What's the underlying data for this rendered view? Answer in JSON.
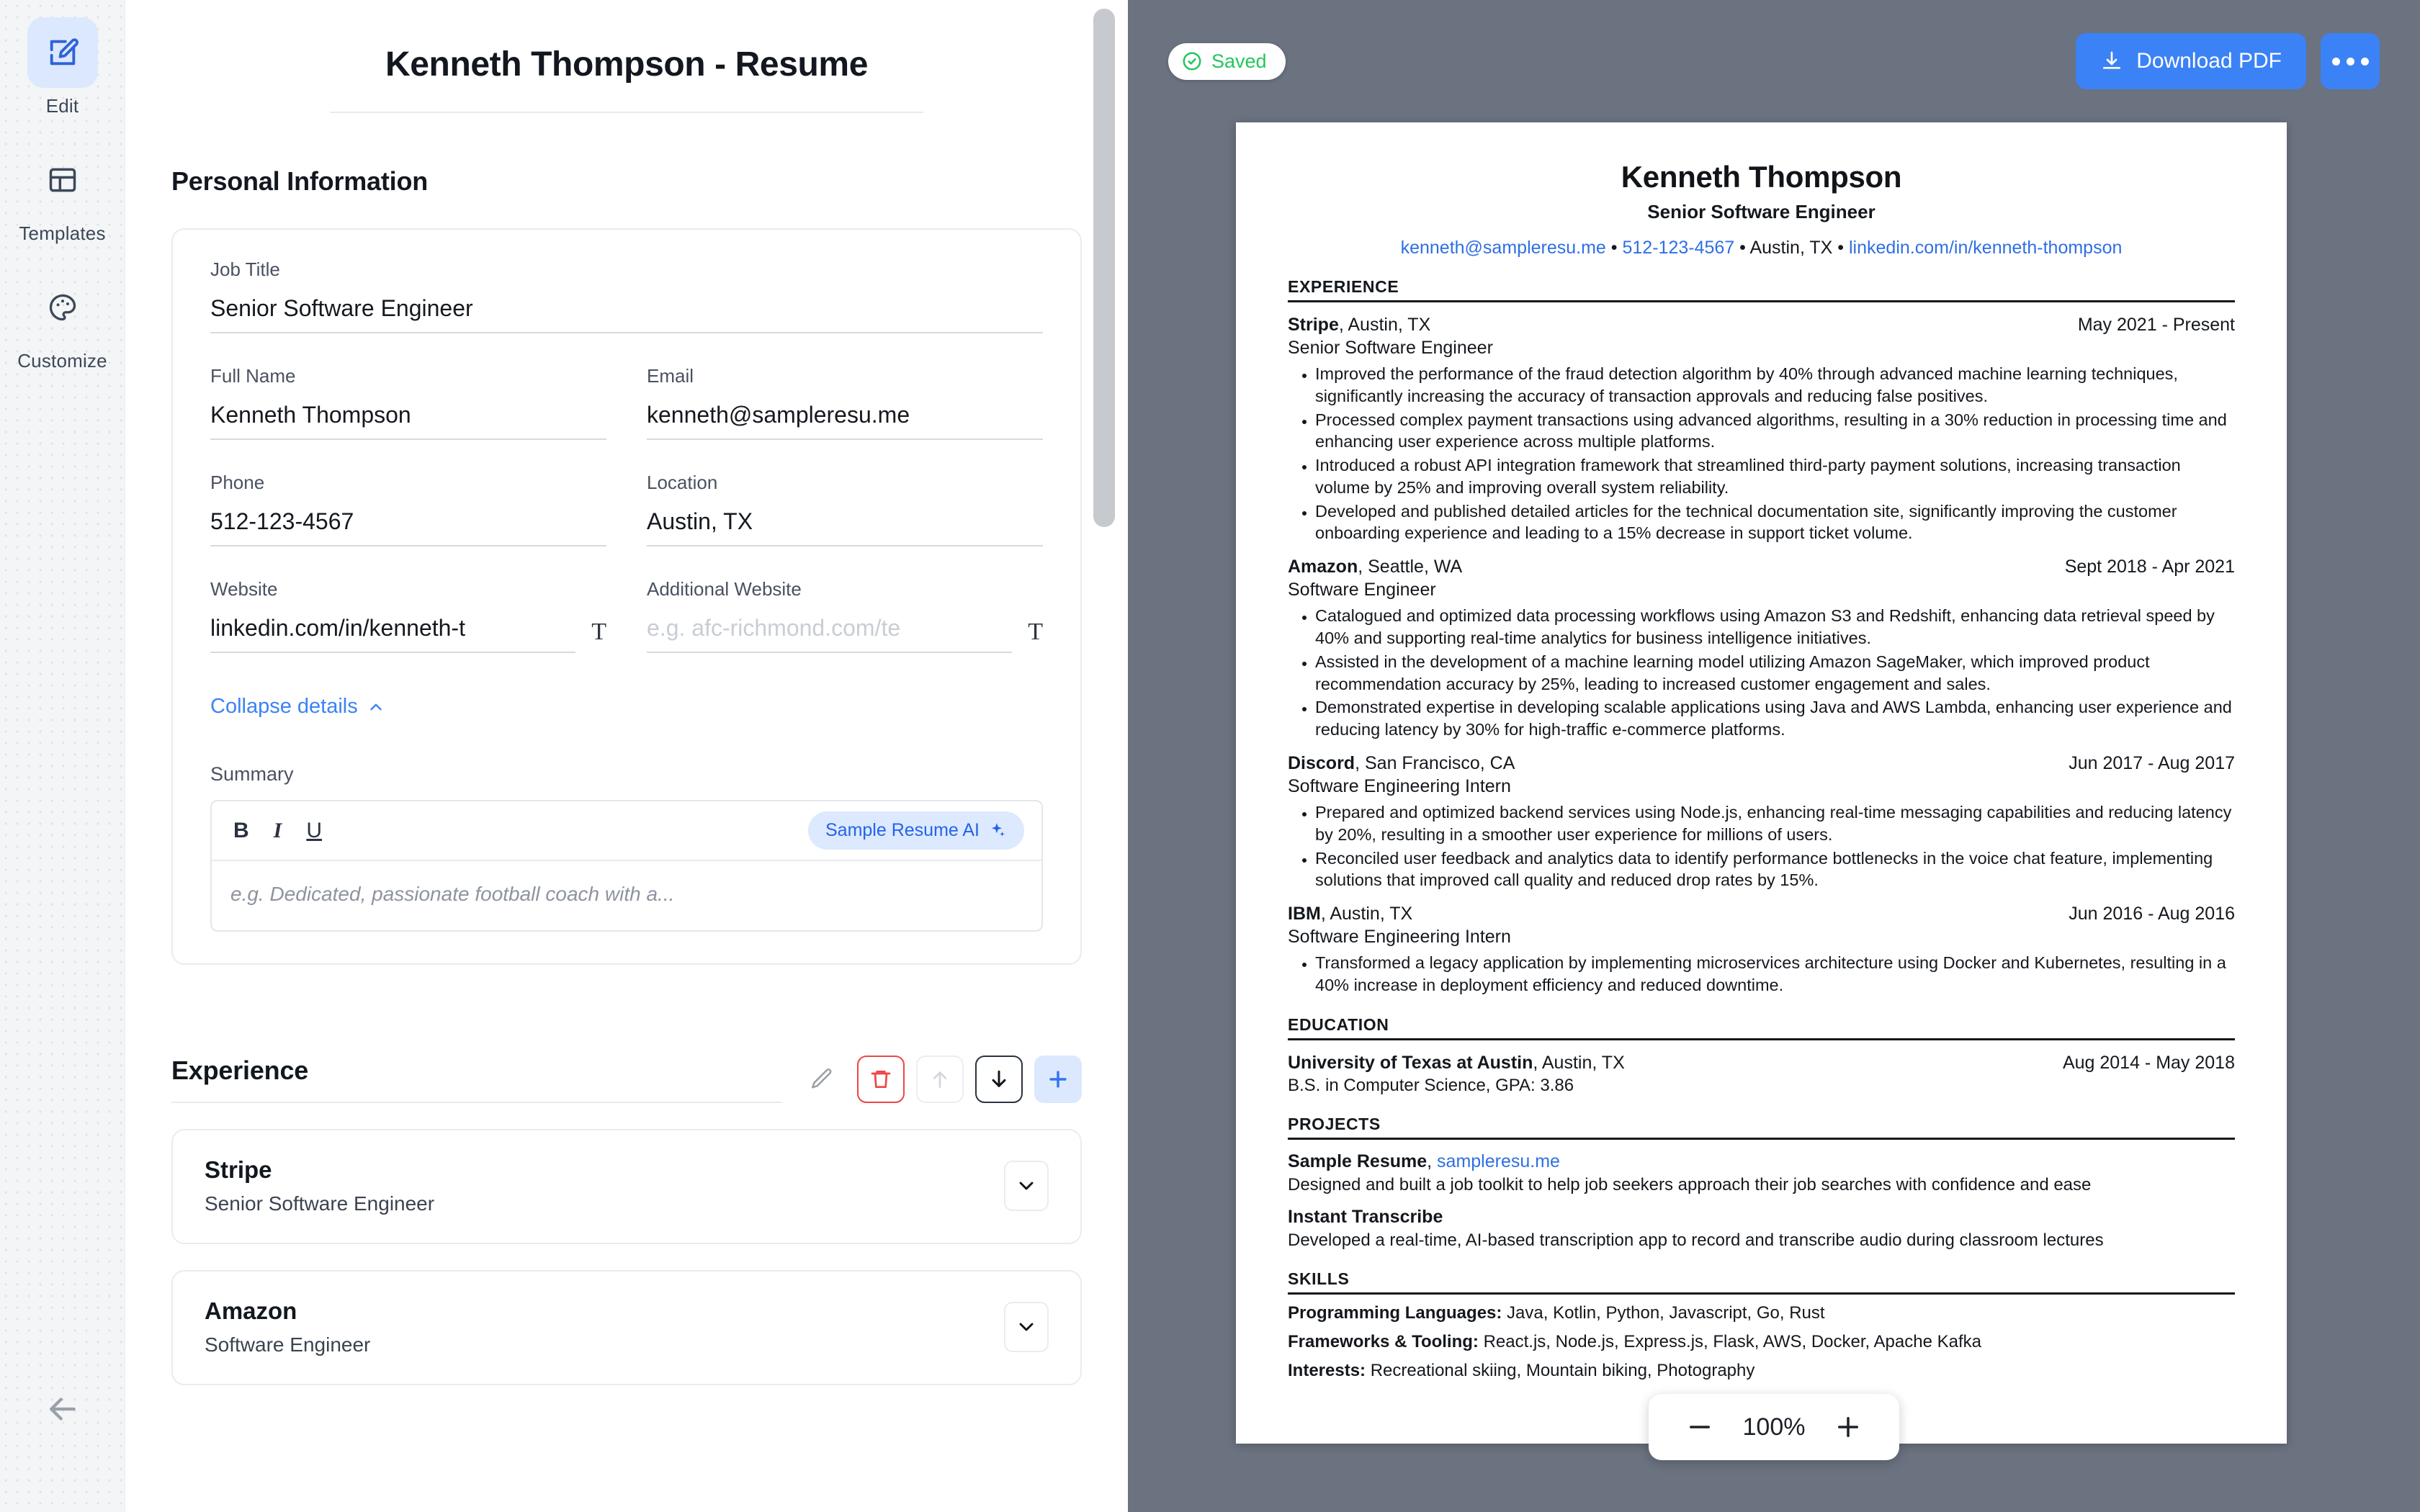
{
  "rail": {
    "items": [
      {
        "label": "Edit",
        "icon": "edit-square-icon",
        "active": true
      },
      {
        "label": "Templates",
        "icon": "layout-template-icon",
        "active": false
      },
      {
        "label": "Customize",
        "icon": "palette-icon",
        "active": false
      }
    ],
    "back_icon": "arrow-left-icon"
  },
  "form": {
    "doc_title": "Kenneth Thompson - Resume",
    "personal_section_title": "Personal Information",
    "fields": {
      "job_title": {
        "label": "Job Title",
        "value": "Senior Software Engineer"
      },
      "full_name": {
        "label": "Full Name",
        "value": "Kenneth Thompson"
      },
      "email": {
        "label": "Email",
        "value": "kenneth@sampleresu.me"
      },
      "phone": {
        "label": "Phone",
        "value": "512-123-4567"
      },
      "location": {
        "label": "Location",
        "value": "Austin, TX"
      },
      "website": {
        "label": "Website",
        "value": "linkedin.com/in/kenneth-t"
      },
      "additional_website": {
        "label": "Additional Website",
        "value": "",
        "placeholder": "e.g. afc-richmond.com/te"
      }
    },
    "collapse_link": "Collapse details",
    "summary": {
      "label": "Summary",
      "bold_label": "B",
      "italic_label": "I",
      "underline_label": "U",
      "ai_button": "Sample Resume AI",
      "placeholder": "e.g. Dedicated, passionate football coach with a..."
    },
    "experience_section": {
      "title": "Experience",
      "tools": [
        {
          "name": "edit-pencil-icon",
          "style": "plain"
        },
        {
          "name": "trash-icon",
          "style": "danger"
        },
        {
          "name": "arrow-up-icon",
          "style": "muted"
        },
        {
          "name": "arrow-down-icon",
          "style": "dark"
        },
        {
          "name": "plus-icon",
          "style": "accent"
        }
      ],
      "entries": [
        {
          "org": "Stripe",
          "role": "Senior Software Engineer"
        },
        {
          "org": "Amazon",
          "role": "Software Engineer"
        }
      ]
    }
  },
  "preview": {
    "saved_label": "Saved",
    "saved_icon": "check-circle-icon",
    "download_label": "Download PDF",
    "download_icon": "download-icon",
    "more_label": "more-options",
    "zoom": {
      "value": "100%",
      "minus": "minus-icon",
      "plus": "plus-icon"
    },
    "accent_blue": "#3b82f6",
    "saved_green": "#22c55e",
    "panel_bg": "#6b7280",
    "resume": {
      "name": "Kenneth Thompson",
      "headline": "Senior Software Engineer",
      "contact": {
        "email": "kenneth@sampleresu.me",
        "phone": "512-123-4567",
        "location": "Austin, TX",
        "website": "linkedin.com/in/kenneth-thompson",
        "separator": " • "
      },
      "sections": {
        "experience": "EXPERIENCE",
        "education": "EDUCATION",
        "projects": "PROJECTS",
        "skills": "SKILLS"
      },
      "experience": [
        {
          "org": "Stripe",
          "location": ", Austin, TX",
          "dates": "May 2021 - Present",
          "position": "Senior Software Engineer",
          "bullets": [
            "Improved the performance of the fraud detection algorithm by 40% through advanced machine learning techniques, significantly increasing the accuracy of transaction approvals and reducing false positives.",
            "Processed complex payment transactions using advanced algorithms, resulting in a 30% reduction in processing time and enhancing user experience across multiple platforms.",
            "Introduced a robust API integration framework that streamlined third-party payment solutions, increasing transaction volume by 25% and improving overall system reliability.",
            "Developed and published detailed articles for the technical documentation site, significantly improving the customer onboarding experience and leading to a 15% decrease in support ticket volume."
          ]
        },
        {
          "org": "Amazon",
          "location": ", Seattle, WA",
          "dates": "Sept 2018 - Apr 2021",
          "position": "Software Engineer",
          "bullets": [
            "Catalogued and optimized data processing workflows using Amazon S3 and Redshift, enhancing data retrieval speed by 40% and supporting real-time analytics for business intelligence initiatives.",
            "Assisted in the development of a machine learning model utilizing Amazon SageMaker, which improved product recommendation accuracy by 25%, leading to increased customer engagement and sales.",
            "Demonstrated expertise in developing scalable applications using Java and AWS Lambda, enhancing user experience and reducing latency by 30% for high-traffic e-commerce platforms."
          ]
        },
        {
          "org": "Discord",
          "location": ", San Francisco, CA",
          "dates": "Jun 2017 - Aug 2017",
          "position": "Software Engineering Intern",
          "bullets": [
            "Prepared and optimized backend services using Node.js, enhancing real-time messaging capabilities and reducing latency by 20%, resulting in a smoother user experience for millions of users.",
            "Reconciled user feedback and analytics data to identify performance bottlenecks in the voice chat feature, implementing solutions that improved call quality and reduced drop rates by 15%."
          ]
        },
        {
          "org": "IBM",
          "location": ", Austin, TX",
          "dates": "Jun 2016 - Aug 2016",
          "position": "Software Engineering Intern",
          "bullets": [
            "Transformed a legacy application by implementing microservices architecture using Docker and Kubernetes, resulting in a 40% increase in deployment efficiency and reduced downtime."
          ]
        }
      ],
      "education": [
        {
          "school": "University of Texas at Austin",
          "location": ", Austin, TX",
          "dates": "Aug 2014 - May 2018",
          "degree": "B.S. in Computer Science, GPA: 3.86"
        }
      ],
      "projects": [
        {
          "name": "Sample Resume",
          "link": "sampleresu.me",
          "description": "Designed and built a job toolkit to help job seekers approach their job searches with confidence and ease"
        },
        {
          "name": "Instant Transcribe",
          "link": "",
          "description": "Developed a real-time, AI-based transcription app to record and transcribe audio during classroom lectures"
        }
      ],
      "skills": [
        {
          "label": "Programming Languages:",
          "value": " Java, Kotlin, Python, Javascript, Go, Rust"
        },
        {
          "label": "Frameworks & Tooling:",
          "value": " React.js, Node.js, Express.js, Flask, AWS, Docker, Apache Kafka"
        },
        {
          "label": "Interests:",
          "value": " Recreational skiing, Mountain biking, Photography"
        }
      ]
    }
  }
}
